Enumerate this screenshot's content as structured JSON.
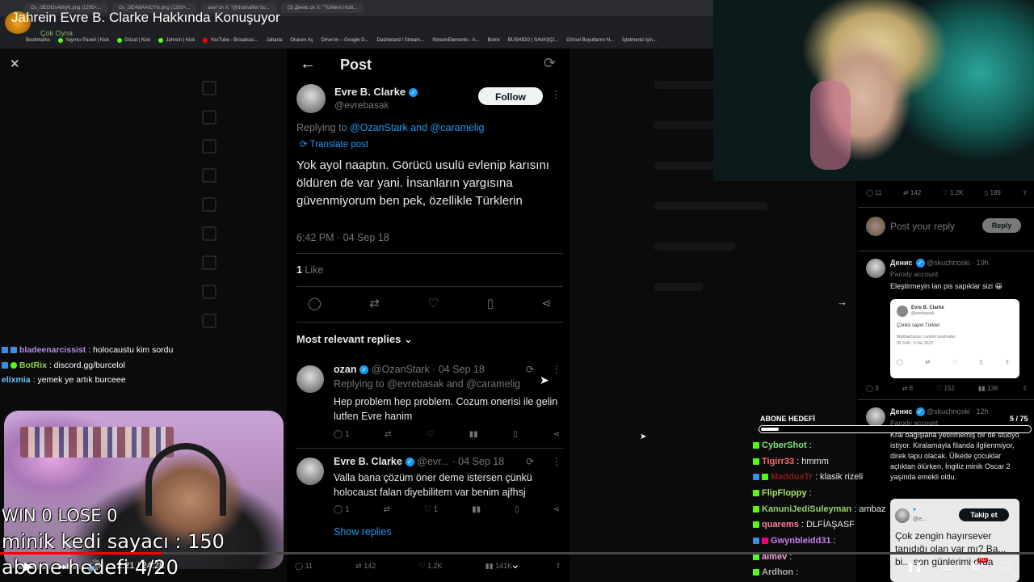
{
  "stream": {
    "title": "Jahrein Evre B. Clarke Hakkında Konuşuyor",
    "logo_text": "Çok Oyna"
  },
  "browser": {
    "tabs": [
      "Gs_i3EI3OsAkhyK.png (1205×...",
      "Gs_i3E4WAAICYIs.png (1205×...",
      "asef on X: \"@dramafikri bu...",
      "(3) Денис on X: \"Türklere Hobi..."
    ],
    "bookmarks": [
      "Bookmarks",
      "Yayıncı Paneli | Kick",
      "Gözat | Kick",
      "Jahrein | Kick",
      "YouTube - Broadcas...",
      "Jaharia",
      "Oturum Aç",
      "Drive'ım – Google D...",
      "Dashboard / Stream...",
      "StreamElements - A...",
      "Botrix",
      "BUSHIDO | SAVAŞÇI...",
      "Görsel Boyutlarını N...",
      "İşletmeniz için..."
    ]
  },
  "post": {
    "header_title": "Post",
    "author_name": "Evre B. Clarke",
    "author_handle": "@evrebasak",
    "follow_label": "Follow",
    "replying_prefix": "Replying to ",
    "replying_to": "@OzanStark and @caramelig",
    "translate_label": "Translate post",
    "body": "Yok ayol naaptın. Görücü usulü evlenip karısını öldüren de var yani. İnsanların yargısına güvenmiyorum ben pek, özellikle Türklerin",
    "time": "6:42 PM · 04 Sep 18",
    "likes_number": "1",
    "likes_label": " Like",
    "sort_label": "Most relevant replies",
    "bottom_stats": [
      "11",
      "142",
      "1.2K",
      "141K"
    ]
  },
  "replies": [
    {
      "name": "ozan",
      "handle_date": "@OzanStark · 04 Sep 18",
      "replying": "Replying to @evrebasak and @caramelig",
      "text": "Hep problem hep problem. Cozum onerisi ile gelin lutfen Evre hanim",
      "reply_count": "1",
      "like_count": ""
    },
    {
      "name": "Evre B. Clarke",
      "handle_date": "@evr... · 04 Sep 18",
      "replying": "",
      "text": "Valla bana çözüm öner deme istersen çünkü holocaust falan diyebilitem var benim ajfhsj",
      "reply_count": "1",
      "like_count": "1"
    }
  ],
  "show_replies": "Show replies",
  "right_panel": {
    "stats": [
      "11",
      "142",
      "1.2K",
      "189"
    ],
    "compose_placeholder": "Post your reply",
    "reply_btn": "Reply",
    "tweet1_name": "Денис",
    "tweet1_handle": "@skuchnoski · 19h",
    "tweet1_parody": "Parody account",
    "tweet1_text": "Eleştirmeyin lan pis sapıklar sizi 😀",
    "quote_name": "Evre B. Clarke",
    "quote_handle": "@evrebasak",
    "quote_text": "Çünkü sapık Türkler",
    "quote_location": "Walthamstow, London tarafından",
    "quote_date": "05 3:40 · 6 Nis 2022",
    "tweet1_stats": [
      "3",
      "8",
      "152",
      "13K"
    ],
    "tweet2_name": "Денис",
    "tweet2_handle": "@skuchnoski · 12h",
    "tweet2_parody": "Parody account",
    "tweet2_text": "Kral bağışlarla yetinmemiş bir de stüdyo istiyor. Kiralamayla filanda ilgilenmiyor, direk tapu olacak. Ülkede çocuklar açlıktan ölürken, İngiliz minik Oscar 2 yaşında emekli oldu.",
    "pip_follow": "Takip et",
    "pip_handle": "@e...",
    "pip_text": "Çok zengin hayırsever tanıdığı olan var mı? Ba... bi... son günlerimi orda"
  },
  "overlay": {
    "win_lose": "WIN 0 LOSE 0",
    "kedi": "minik kedi sayacı : 150",
    "abone": "abone hedefi 4/20",
    "player_time": "2:21 / 24:28",
    "quality_badge": "HD"
  },
  "chat_left": [
    {
      "user": "bladeenarcissist",
      "msg": ": holocaustu kim sordu",
      "color": "#b48ce8"
    },
    {
      "user": "BotRix",
      "msg": ": discord.gg/burcelol",
      "color": "#8fd14f"
    },
    {
      "user": "elixmia",
      "msg": ": yemek ye artık burceee",
      "color": "#6ec6ff"
    }
  ],
  "sub_goal": {
    "label": "ABONE HEDEFİ",
    "count": "5 / 75",
    "progress": 0.0667
  },
  "chat_right": [
    {
      "user": "CyberShot",
      "msg": ":",
      "color": "#7de37d"
    },
    {
      "user": "Tigirr33",
      "msg": ": hmmm",
      "color": "#ff6a6a"
    },
    {
      "user": "MaddoxTr",
      "msg": ": klasik rizeli",
      "color": "#8b1a1a"
    },
    {
      "user": "FlipFloppy",
      "msg": ":",
      "color": "#a7e36a"
    },
    {
      "user": "KanuniJediSuleyman",
      "msg": ": ambaz",
      "color": "#9ad16a"
    },
    {
      "user": "quarems",
      "msg": ": DLFİAŞASF",
      "color": "#ff7a9c"
    },
    {
      "user": "Gwynbleidd31",
      "msg": ":",
      "color": "#cf7df2"
    },
    {
      "user": "aimev",
      "msg": ":",
      "color": "#ff9fe0"
    },
    {
      "user": "Ardhon",
      "msg": ":",
      "color": "#b0b0b0"
    }
  ]
}
